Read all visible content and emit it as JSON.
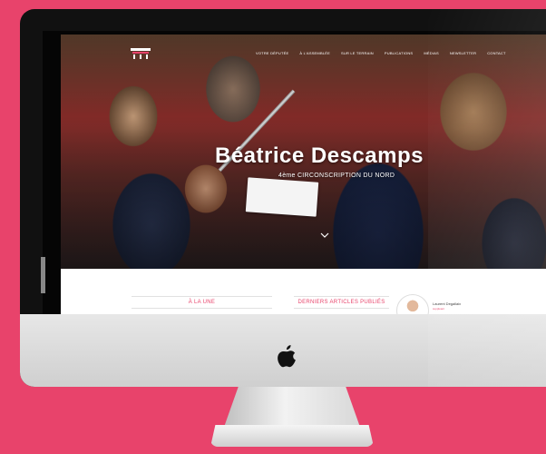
{
  "site": {
    "title": "Béatrice Descamps",
    "subtitle": "4ème CIRCONSCRIPTION DU NORD"
  },
  "nav": {
    "items": [
      {
        "label": "VOTRE DÉPUTÉE"
      },
      {
        "label": "À L'ASSEMBLÉE"
      },
      {
        "label": "SUR LE TERRAIN"
      },
      {
        "label": "PUBLICATIONS"
      },
      {
        "label": "MÉDIAS"
      },
      {
        "label": "NEWSLETTER"
      },
      {
        "label": "CONTACT"
      }
    ]
  },
  "content": {
    "section_une": "À LA UNE",
    "section_articles": "DERNIERS ARTICLES PUBLIÉS"
  },
  "author": {
    "name": "Laurent Degallaix",
    "role": "suppléant"
  },
  "colors": {
    "background": "#e8436b",
    "accent": "#e8436b"
  },
  "icons": {
    "apple": "apple-icon",
    "logo": "assembly-logo-icon",
    "scroll": "chevron-down-icon"
  }
}
